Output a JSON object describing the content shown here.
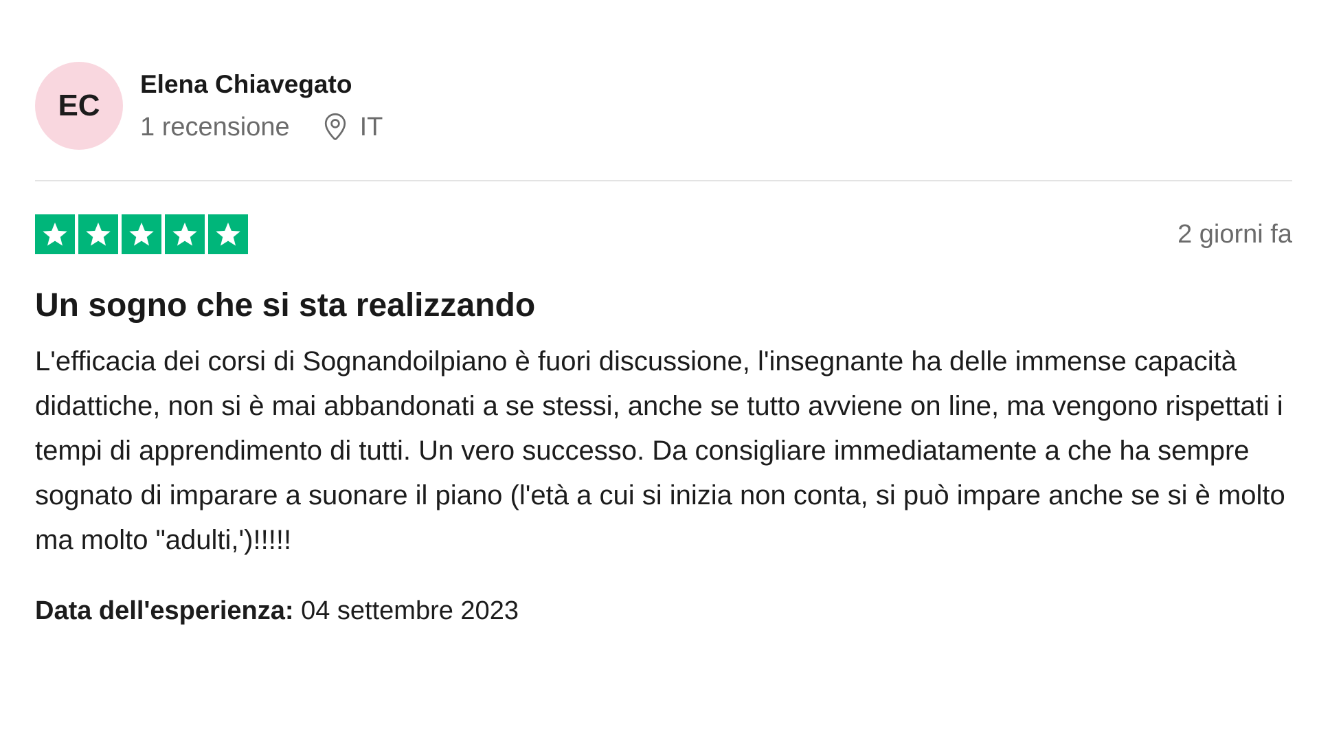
{
  "reviewer": {
    "initials": "EC",
    "name": "Elena Chiavegato",
    "review_count": "1 recensione",
    "country": "IT",
    "avatar_color": "#f9d7df"
  },
  "rating": {
    "stars": 5,
    "max_stars": 5,
    "star_color": "#00b67a",
    "icon": "star-icon"
  },
  "review": {
    "posted": "2 giorni fa",
    "title": "Un sogno che si sta realizzando",
    "body": "L'efficacia dei corsi di Sognandoilpiano è fuori discussione, l'insegnante ha delle immense capacità didattiche, non si è mai abbandonati a se stessi, anche se tutto avviene on line, ma vengono rispettati i tempi di apprendimento di tutti. Un vero successo. Da consigliare immediatamente a che ha sempre sognato di imparare a suonare il piano (l'età a cui si inizia non conta, si può impare anche se si è molto ma molto \"adulti,')!!!!!"
  },
  "experience": {
    "label": "Data dell'esperienza:",
    "date": "04 settembre 2023"
  },
  "icons": {
    "location": "location-pin-icon"
  }
}
